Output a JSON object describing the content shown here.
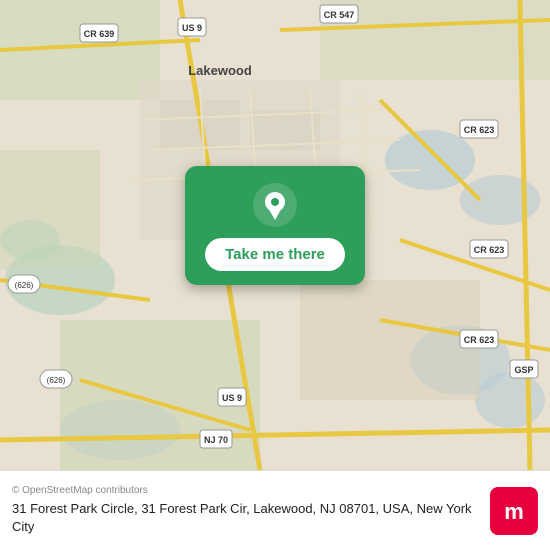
{
  "map": {
    "background_color": "#e0d8cc",
    "center_lat": 40.096,
    "center_lng": -74.2143
  },
  "card": {
    "button_label": "Take me there",
    "background_color": "#2e9e5b",
    "button_text_color": "#2e9e5b"
  },
  "footer": {
    "osm_credit": "© OpenStreetMap contributors",
    "address": "31 Forest Park Circle, 31 Forest Park Cir, Lakewood, NJ 08701, USA, New York City",
    "moovit_label": "moovit"
  },
  "road_labels": {
    "us9_top": "US 9",
    "us9_bottom": "US 9",
    "cr547": "CR 547",
    "cr639": "CR 639",
    "cr623_top": "CR 623",
    "cr623_mid": "CR 623",
    "cr623_bot": "CR 623",
    "cr626_left": "(626)",
    "cr626_bottom": "(626)",
    "nj70": "NJ 70",
    "gsp": "GSP",
    "lakewood_label": "Lakewood"
  }
}
